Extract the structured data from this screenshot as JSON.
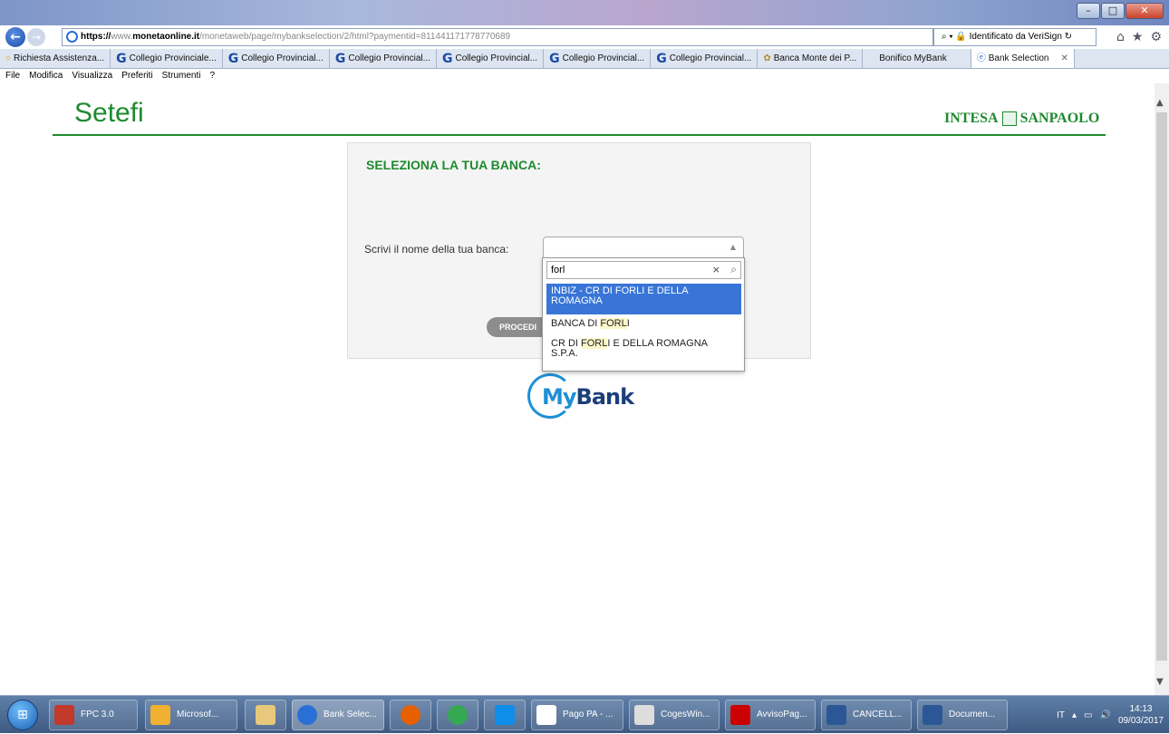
{
  "browser": {
    "address": {
      "protocol": "https://",
      "prefix": "www.",
      "domain": "monetaonline.it",
      "path": "/monetaweb/page/mybankselection/2/html?paymentid=811441171778770689"
    },
    "security_text": "Identificato da VeriSign",
    "tabs": [
      {
        "label": "Richiesta Assistenza..."
      },
      {
        "label": "Collegio Provinciale..."
      },
      {
        "label": "Collegio Provincial..."
      },
      {
        "label": "Collegio Provincial..."
      },
      {
        "label": "Collegio Provincial..."
      },
      {
        "label": "Collegio Provincial..."
      },
      {
        "label": "Collegio Provincial..."
      },
      {
        "label": "Banca Monte dei P..."
      },
      {
        "label": "Bonifico MyBank"
      },
      {
        "label": "Bank Selection"
      }
    ],
    "menu": [
      "File",
      "Modifica",
      "Visualizza",
      "Preferiti",
      "Strumenti",
      "?"
    ]
  },
  "page": {
    "brand_left": "Setefi",
    "brand_right_a": "INTESA",
    "brand_right_b": "SANPAOLO",
    "panel_title": "SELEZIONA LA TUA BANCA:",
    "bank_label": "Scrivi il nome della tua banca:",
    "proceed_label": "PROCEDI",
    "search_value": "forl",
    "options": [
      {
        "pre": "INBIZ - CR DI FORLI E DELLA ROMAGNA",
        "selected": true
      },
      {
        "pre": "BANCA DI ",
        "match": "FORL",
        "post": "I"
      },
      {
        "pre": "CR DI ",
        "match": "FORL",
        "post": "I E DELLA ROMAGNA S.P.A."
      }
    ],
    "mybank_my": "My",
    "mybank_bank": "Bank"
  },
  "taskbar": {
    "items": [
      {
        "label": "FPC 3.0"
      },
      {
        "label": "Microsof..."
      },
      {
        "label": "Bank Selec..."
      },
      {
        "label": "Pago PA - ..."
      },
      {
        "label": "CogesWin..."
      },
      {
        "label": "AvvisoPag..."
      },
      {
        "label": "CANCELL..."
      },
      {
        "label": "Documen..."
      }
    ],
    "lang": "IT",
    "time": "14:13",
    "date": "09/03/2017"
  },
  "colors": {
    "brand_green": "#1e8a2f",
    "highlight_blue": "#3875d7",
    "mybank_blue": "#1e90d6"
  }
}
